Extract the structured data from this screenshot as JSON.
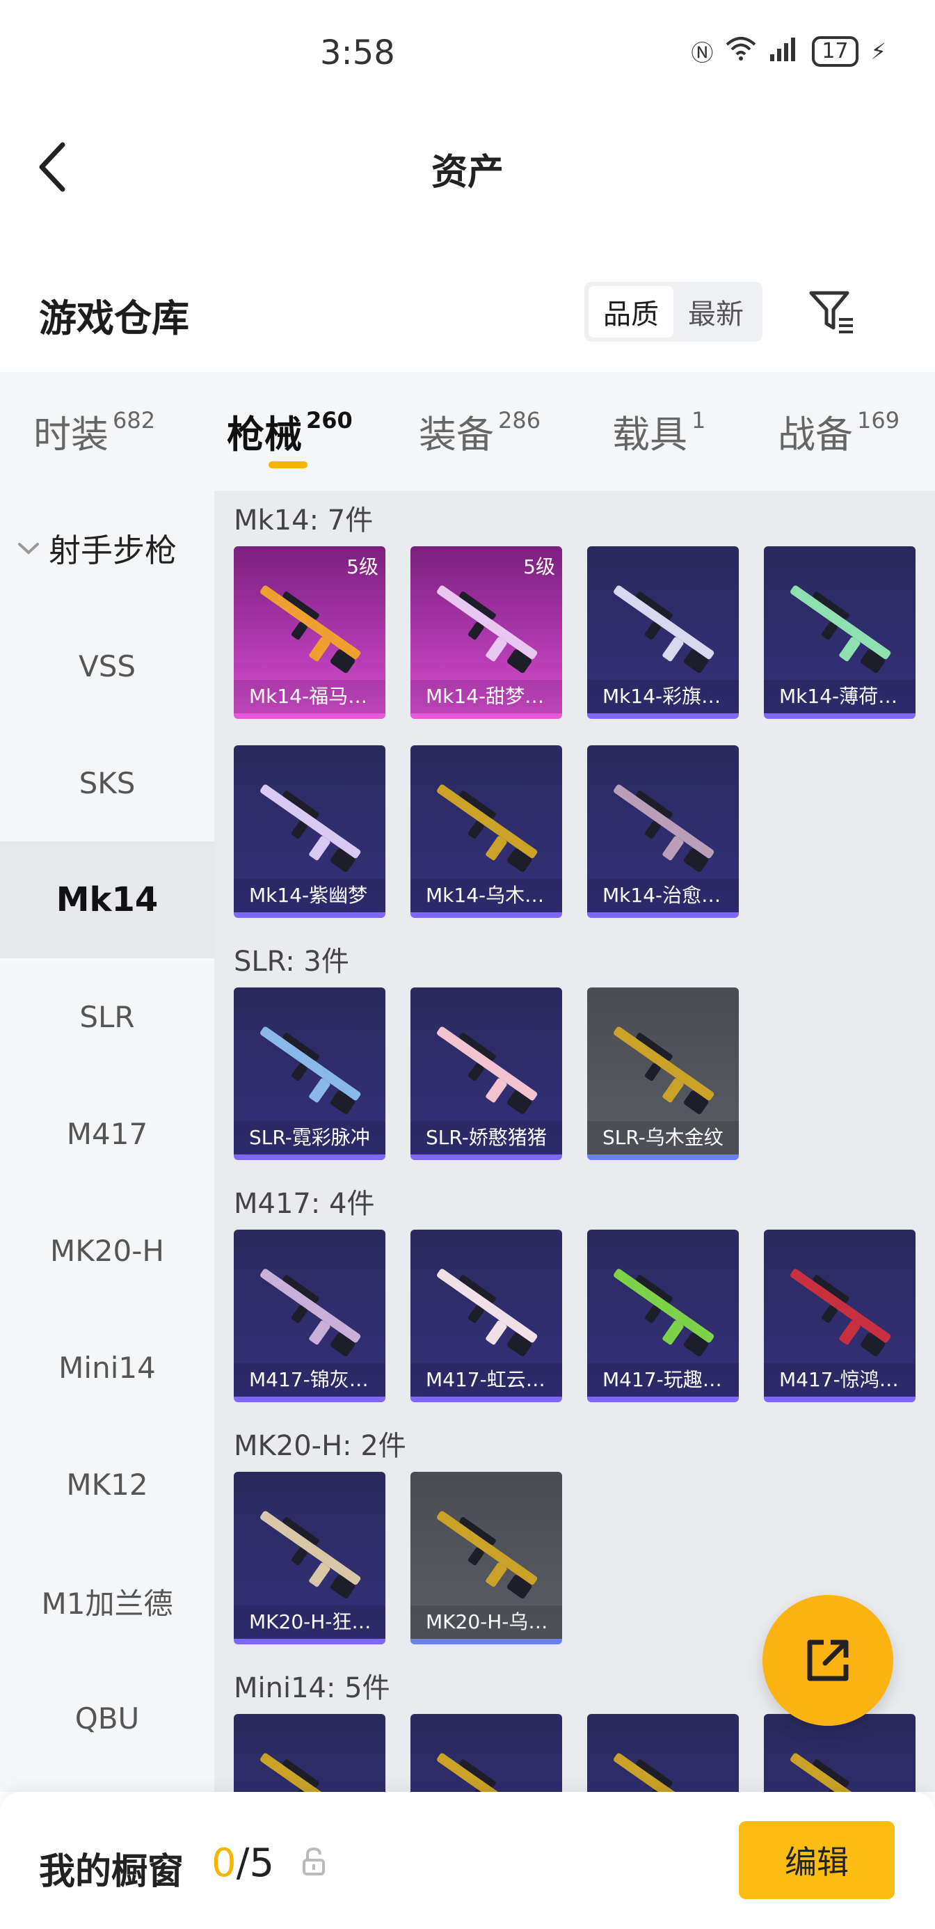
{
  "status_bar": {
    "time": "3:58",
    "network": "4G",
    "wifi_badge": "6",
    "battery": "17"
  },
  "header": {
    "title": "资产"
  },
  "repository": {
    "title": "游戏仓库",
    "sort_options": [
      "品质",
      "最新"
    ],
    "sort_selected": "品质"
  },
  "tabs": [
    {
      "label": "时装",
      "count": "682"
    },
    {
      "label": "枪械",
      "count": "260"
    },
    {
      "label": "装备",
      "count": "286"
    },
    {
      "label": "载具",
      "count": "1"
    },
    {
      "label": "战备",
      "count": "169"
    }
  ],
  "active_tab": "枪械",
  "sidebar": {
    "group": "射手步枪",
    "items": [
      "VSS",
      "SKS",
      "Mk14",
      "SLR",
      "M417",
      "MK20-H",
      "Mini14",
      "MK12",
      "M1加兰德",
      "QBU"
    ],
    "active": "Mk14"
  },
  "groups": [
    {
      "title": "Mk14: 7件",
      "items": [
        {
          "name": "Mk14-福马…",
          "level": "5级",
          "quality": "pink",
          "color": "#f0a030"
        },
        {
          "name": "Mk14-甜梦…",
          "level": "5级",
          "quality": "pink",
          "color": "#e8c7f0"
        },
        {
          "name": "Mk14-彩旗…",
          "level": "",
          "quality": "purple",
          "color": "#d8d8ef"
        },
        {
          "name": "Mk14-薄荷…",
          "level": "",
          "quality": "purple",
          "color": "#8fe0b0"
        },
        {
          "name": "Mk14-紫幽梦",
          "level": "",
          "quality": "purple",
          "color": "#d9c9f5"
        },
        {
          "name": "Mk14-乌木…",
          "level": "",
          "quality": "purple",
          "color": "#c9a227"
        },
        {
          "name": "Mk14-治愈…",
          "level": "",
          "quality": "purple",
          "color": "#b9a0b8"
        }
      ]
    },
    {
      "title": "SLR: 3件",
      "items": [
        {
          "name": "SLR-霓彩脉冲",
          "level": "",
          "quality": "purple",
          "color": "#8ab8e8"
        },
        {
          "name": "SLR-娇憨猪猪",
          "level": "",
          "quality": "purple",
          "color": "#f4c3d0"
        },
        {
          "name": "SLR-乌木金纹",
          "level": "",
          "quality": "grey",
          "color": "#c9a227"
        }
      ]
    },
    {
      "title": "M417: 4件",
      "items": [
        {
          "name": "M417-锦灰…",
          "level": "",
          "quality": "purple",
          "color": "#c8b0d8"
        },
        {
          "name": "M417-虹云…",
          "level": "",
          "quality": "purple",
          "color": "#f0e0e8"
        },
        {
          "name": "M417-玩趣…",
          "level": "",
          "quality": "purple",
          "color": "#7ed24a"
        },
        {
          "name": "M417-惊鸿…",
          "level": "",
          "quality": "purple",
          "color": "#c83040"
        }
      ]
    },
    {
      "title": "MK20-H: 2件",
      "items": [
        {
          "name": "MK20-H-狂…",
          "level": "",
          "quality": "purple",
          "color": "#d8c8a8"
        },
        {
          "name": "MK20-H-乌…",
          "level": "",
          "quality": "grey",
          "color": "#c9a227"
        }
      ]
    },
    {
      "title": "Mini14: 5件",
      "items": [
        {
          "name": "",
          "level": "",
          "quality": "purple",
          "color": "#c9a227"
        },
        {
          "name": "",
          "level": "",
          "quality": "purple",
          "color": "#c9a227"
        },
        {
          "name": "",
          "level": "",
          "quality": "purple",
          "color": "#c9a227"
        },
        {
          "name": "",
          "level": "",
          "quality": "purple",
          "color": "#c9a227"
        }
      ]
    }
  ],
  "bottom": {
    "label": "我的橱窗",
    "current": "0",
    "total": "/5",
    "edit_label": "编辑"
  },
  "colors": {
    "accent": "#f5b400",
    "fab": "#fbb314"
  }
}
